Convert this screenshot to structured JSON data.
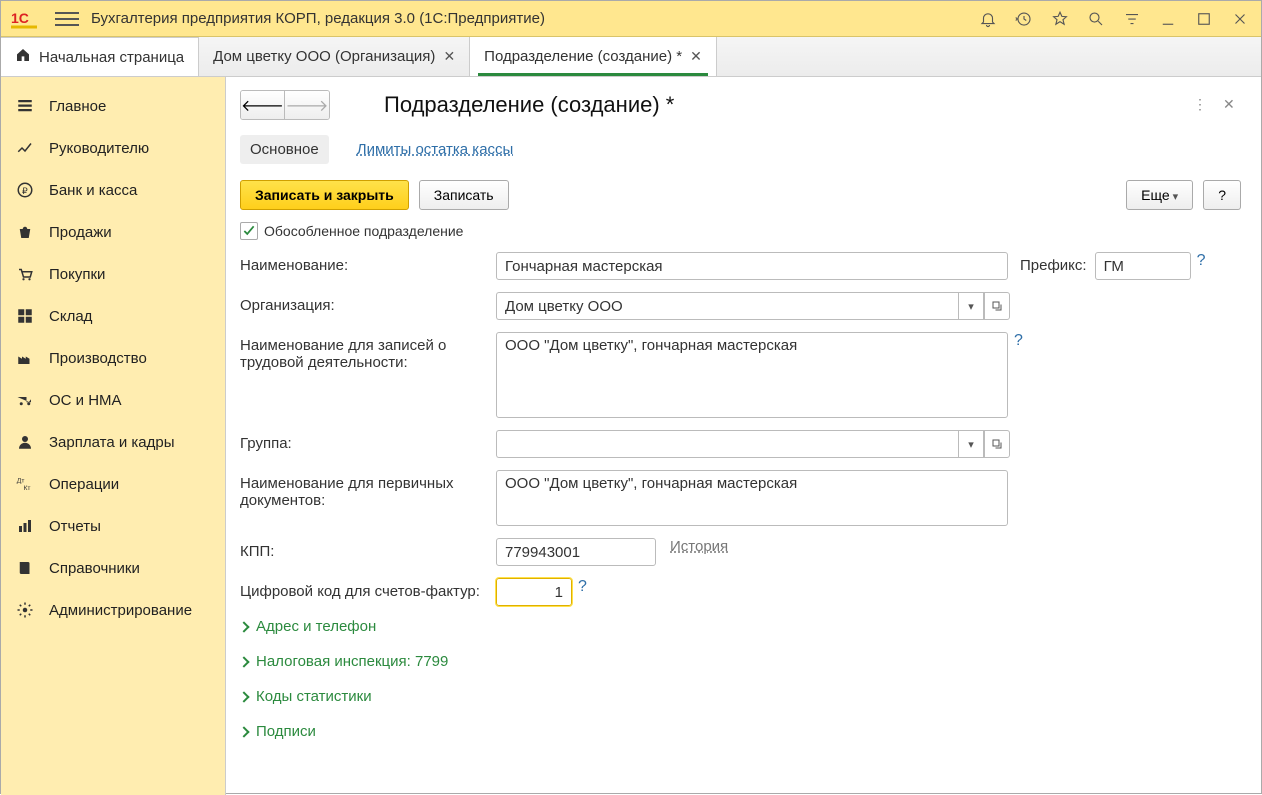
{
  "window": {
    "title": "Бухгалтерия предприятия КОРП, редакция 3.0  (1С:Предприятие)"
  },
  "tabs": {
    "home": "Начальная страница",
    "t1": "Дом цветку ООО (Организация)",
    "t2": "Подразделение (создание) *"
  },
  "sidebar": {
    "items": [
      "Главное",
      "Руководителю",
      "Банк и касса",
      "Продажи",
      "Покупки",
      "Склад",
      "Производство",
      "ОС и НМА",
      "Зарплата и кадры",
      "Операции",
      "Отчеты",
      "Справочники",
      "Администрирование"
    ]
  },
  "page": {
    "title": "Подразделение (создание) *",
    "subtabs": {
      "main": "Основное",
      "limits": "Лимиты остатка кассы"
    },
    "buttons": {
      "save_close": "Записать и закрыть",
      "save": "Записать",
      "more": "Еще",
      "help": "?"
    },
    "checkbox": {
      "label": "Обособленное подразделение",
      "checked": true
    },
    "labels": {
      "name": "Наименование:",
      "prefix": "Префикс:",
      "org": "Организация:",
      "labor_name": "Наименование для записей о трудовой деятельности:",
      "group": "Группа:",
      "doc_name": "Наименование для первичных документов:",
      "kpp": "КПП:",
      "history": "История",
      "digit_code": "Цифровой код для счетов-фактур:"
    },
    "values": {
      "name": "Гончарная мастерская",
      "prefix": "ГМ",
      "org": "Дом цветку ООО",
      "labor_name": "ООО \"Дом цветку\", гончарная мастерская",
      "group": "",
      "doc_name": "ООО \"Дом цветку\", гончарная мастерская",
      "kpp": "779943001",
      "digit_code": "1"
    },
    "expands": [
      "Адрес и телефон",
      "Налоговая инспекция: 7799",
      "Коды статистики",
      "Подписи"
    ]
  }
}
